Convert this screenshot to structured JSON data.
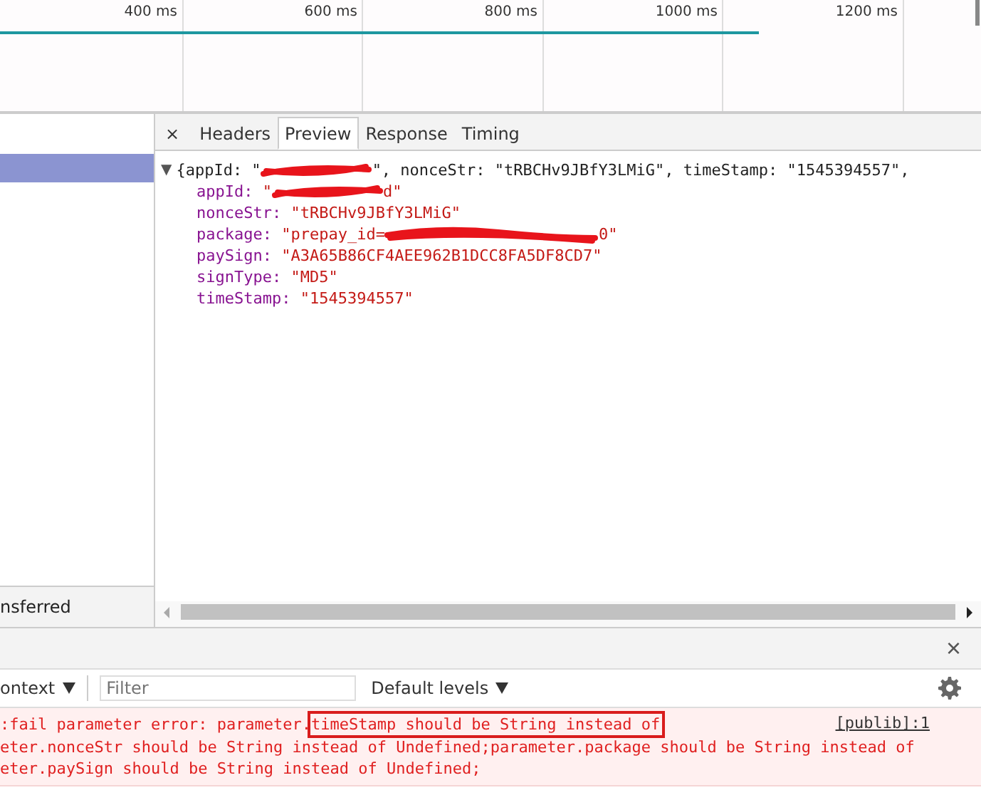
{
  "timeline": {
    "ticks": [
      "400 ms",
      "600 ms",
      "800 ms",
      "1000 ms",
      "1200 ms"
    ]
  },
  "request_list": {
    "rows": [
      {
        "selected": true
      }
    ],
    "summary": "nsferred"
  },
  "detail_tabs": {
    "close": "×",
    "tabs": [
      {
        "label": "Headers",
        "selected": false
      },
      {
        "label": "Preview",
        "selected": true
      },
      {
        "label": "Response",
        "selected": false
      },
      {
        "label": "Timing",
        "selected": false
      }
    ]
  },
  "preview": {
    "toggle": "▼",
    "lines": [
      {
        "parts": [
          {
            "kind": "plain",
            "text": "{appId: \""
          },
          {
            "kind": "redaction"
          },
          {
            "kind": "plain",
            "text": "\", nonceStr: \"tRBCHv9JBfY3LMiG\", timeStamp: \"1545394557\","
          }
        ]
      },
      {
        "parts": [
          {
            "kind": "key",
            "text": "appId: "
          },
          {
            "kind": "string",
            "text": "\""
          },
          {
            "kind": "redaction"
          },
          {
            "kind": "string",
            "text": "d\""
          }
        ]
      },
      {
        "parts": [
          {
            "kind": "key",
            "text": "nonceStr: "
          },
          {
            "kind": "string",
            "text": "\"tRBCHv9JBfY3LMiG\""
          }
        ]
      },
      {
        "parts": [
          {
            "kind": "key",
            "text": "package: "
          },
          {
            "kind": "string",
            "text": "\"prepay_id="
          },
          {
            "kind": "redaction"
          },
          {
            "kind": "string",
            "text": "0\""
          }
        ]
      },
      {
        "parts": [
          {
            "kind": "key",
            "text": "paySign: "
          },
          {
            "kind": "string",
            "text": "\"A3A65B86CF4AEE962B1DCC8FA5DF8CD7\""
          }
        ]
      },
      {
        "parts": [
          {
            "kind": "key",
            "text": "signType: "
          },
          {
            "kind": "string",
            "text": "\"MD5\""
          }
        ]
      },
      {
        "parts": [
          {
            "kind": "key",
            "text": "timeStamp: "
          },
          {
            "kind": "string",
            "text": "\"1545394557\""
          }
        ]
      }
    ]
  },
  "console": {
    "close": "×",
    "context": "ontext",
    "filter": {
      "placeholder": "Filter"
    },
    "levels": "Default levels",
    "messages": [
      {
        "source": "[publib]:1",
        "lines": [
          [
            {
              "text": ":fail parameter error: parameter.",
              "highlighted": false
            },
            {
              "text": "timeStamp should be String instead of",
              "highlighted": true
            }
          ],
          [
            {
              "text": "eter.nonceStr should be String instead of Undefined;parameter.package should be String instead of",
              "highlighted": false
            }
          ],
          [
            {
              "text": "eter.paySign should be String instead of Undefined;",
              "highlighted": false
            }
          ]
        ]
      }
    ]
  }
}
